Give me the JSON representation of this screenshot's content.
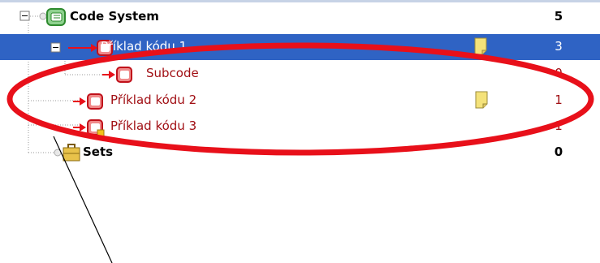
{
  "tree": {
    "root": {
      "label": "Code System",
      "count": "5"
    },
    "items": [
      {
        "label": "Příklad kódu 1",
        "count": "3",
        "memo": true,
        "selected": true,
        "icon": "code-icon"
      },
      {
        "label": "Subcode",
        "count": "0",
        "memo": false,
        "selected": false,
        "icon": "code-icon"
      },
      {
        "label": "Příklad kódu 2",
        "count": "1",
        "memo": true,
        "selected": false,
        "icon": "code-icon"
      },
      {
        "label": "Příklad kódu 3",
        "count": "1",
        "memo": false,
        "selected": false,
        "icon": "code-with-badge-icon"
      }
    ],
    "sets": {
      "label": "Sets",
      "count": "0"
    }
  },
  "colors": {
    "selection": "#2f63c4",
    "code_text": "#a10f14",
    "annotation": "#e8101a",
    "memo_yellow": "#f4e27a"
  }
}
